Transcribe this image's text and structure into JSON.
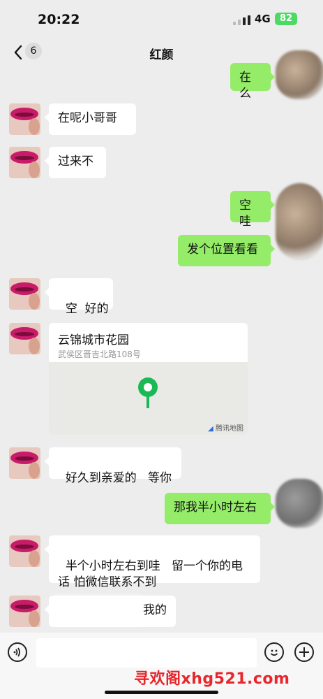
{
  "status_bar": {
    "time": "20:22",
    "network": "4G",
    "battery": "82"
  },
  "nav": {
    "back_count": "6",
    "title": "红颜"
  },
  "messages": [
    {
      "from": "me",
      "text": "在么"
    },
    {
      "from": "them",
      "text": "在呢小哥哥"
    },
    {
      "from": "them",
      "text": "过来不"
    },
    {
      "from": "me",
      "text": "空哇"
    },
    {
      "from": "me",
      "text": "发个位置看看"
    },
    {
      "from": "them",
      "text": "空  好的"
    },
    {
      "from": "them",
      "type": "location",
      "name": "云锦城市花园",
      "address": "武侯区晋吉北路108号",
      "map_credit": "腾讯地图"
    },
    {
      "from": "them",
      "text": "好久到亲爱的   等你"
    },
    {
      "from": "me",
      "text": "那我半小时左右"
    },
    {
      "from": "them",
      "text": "半个小时左右到哇   留一个你的电话 怕微信联系不到"
    },
    {
      "from": "them",
      "text": "我的"
    }
  ],
  "input": {
    "placeholder": ""
  },
  "watermark": "寻欢阁xhg521.com",
  "colors": {
    "bg": "#ededed",
    "out_bubble": "#95ec69",
    "in_bubble": "#ffffff",
    "watermark": "#e8262c",
    "pin": "#19b955"
  }
}
